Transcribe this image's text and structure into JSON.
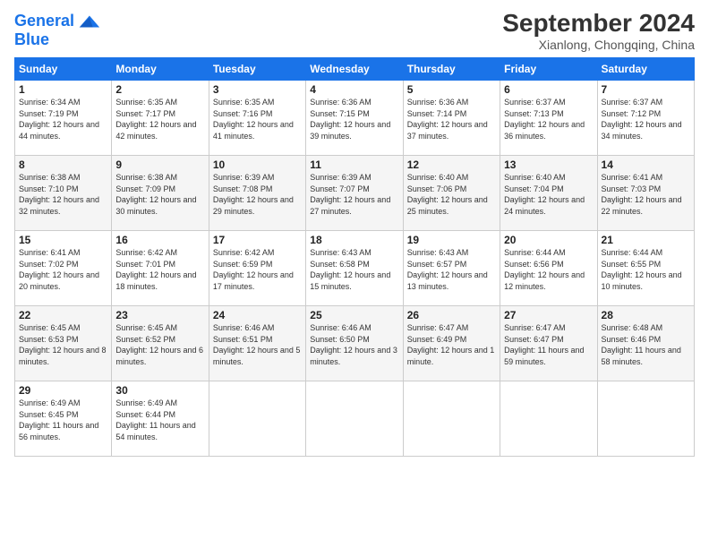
{
  "logo": {
    "line1": "General",
    "line2": "Blue"
  },
  "title": "September 2024",
  "location": "Xianlong, Chongqing, China",
  "weekdays": [
    "Sunday",
    "Monday",
    "Tuesday",
    "Wednesday",
    "Thursday",
    "Friday",
    "Saturday"
  ],
  "weeks": [
    [
      {
        "day": "1",
        "sunrise": "6:34 AM",
        "sunset": "7:19 PM",
        "daylight": "12 hours and 44 minutes."
      },
      {
        "day": "2",
        "sunrise": "6:35 AM",
        "sunset": "7:17 PM",
        "daylight": "12 hours and 42 minutes."
      },
      {
        "day": "3",
        "sunrise": "6:35 AM",
        "sunset": "7:16 PM",
        "daylight": "12 hours and 41 minutes."
      },
      {
        "day": "4",
        "sunrise": "6:36 AM",
        "sunset": "7:15 PM",
        "daylight": "12 hours and 39 minutes."
      },
      {
        "day": "5",
        "sunrise": "6:36 AM",
        "sunset": "7:14 PM",
        "daylight": "12 hours and 37 minutes."
      },
      {
        "day": "6",
        "sunrise": "6:37 AM",
        "sunset": "7:13 PM",
        "daylight": "12 hours and 36 minutes."
      },
      {
        "day": "7",
        "sunrise": "6:37 AM",
        "sunset": "7:12 PM",
        "daylight": "12 hours and 34 minutes."
      }
    ],
    [
      {
        "day": "8",
        "sunrise": "6:38 AM",
        "sunset": "7:10 PM",
        "daylight": "12 hours and 32 minutes."
      },
      {
        "day": "9",
        "sunrise": "6:38 AM",
        "sunset": "7:09 PM",
        "daylight": "12 hours and 30 minutes."
      },
      {
        "day": "10",
        "sunrise": "6:39 AM",
        "sunset": "7:08 PM",
        "daylight": "12 hours and 29 minutes."
      },
      {
        "day": "11",
        "sunrise": "6:39 AM",
        "sunset": "7:07 PM",
        "daylight": "12 hours and 27 minutes."
      },
      {
        "day": "12",
        "sunrise": "6:40 AM",
        "sunset": "7:06 PM",
        "daylight": "12 hours and 25 minutes."
      },
      {
        "day": "13",
        "sunrise": "6:40 AM",
        "sunset": "7:04 PM",
        "daylight": "12 hours and 24 minutes."
      },
      {
        "day": "14",
        "sunrise": "6:41 AM",
        "sunset": "7:03 PM",
        "daylight": "12 hours and 22 minutes."
      }
    ],
    [
      {
        "day": "15",
        "sunrise": "6:41 AM",
        "sunset": "7:02 PM",
        "daylight": "12 hours and 20 minutes."
      },
      {
        "day": "16",
        "sunrise": "6:42 AM",
        "sunset": "7:01 PM",
        "daylight": "12 hours and 18 minutes."
      },
      {
        "day": "17",
        "sunrise": "6:42 AM",
        "sunset": "6:59 PM",
        "daylight": "12 hours and 17 minutes."
      },
      {
        "day": "18",
        "sunrise": "6:43 AM",
        "sunset": "6:58 PM",
        "daylight": "12 hours and 15 minutes."
      },
      {
        "day": "19",
        "sunrise": "6:43 AM",
        "sunset": "6:57 PM",
        "daylight": "12 hours and 13 minutes."
      },
      {
        "day": "20",
        "sunrise": "6:44 AM",
        "sunset": "6:56 PM",
        "daylight": "12 hours and 12 minutes."
      },
      {
        "day": "21",
        "sunrise": "6:44 AM",
        "sunset": "6:55 PM",
        "daylight": "12 hours and 10 minutes."
      }
    ],
    [
      {
        "day": "22",
        "sunrise": "6:45 AM",
        "sunset": "6:53 PM",
        "daylight": "12 hours and 8 minutes."
      },
      {
        "day": "23",
        "sunrise": "6:45 AM",
        "sunset": "6:52 PM",
        "daylight": "12 hours and 6 minutes."
      },
      {
        "day": "24",
        "sunrise": "6:46 AM",
        "sunset": "6:51 PM",
        "daylight": "12 hours and 5 minutes."
      },
      {
        "day": "25",
        "sunrise": "6:46 AM",
        "sunset": "6:50 PM",
        "daylight": "12 hours and 3 minutes."
      },
      {
        "day": "26",
        "sunrise": "6:47 AM",
        "sunset": "6:49 PM",
        "daylight": "12 hours and 1 minute."
      },
      {
        "day": "27",
        "sunrise": "6:47 AM",
        "sunset": "6:47 PM",
        "daylight": "11 hours and 59 minutes."
      },
      {
        "day": "28",
        "sunrise": "6:48 AM",
        "sunset": "6:46 PM",
        "daylight": "11 hours and 58 minutes."
      }
    ],
    [
      {
        "day": "29",
        "sunrise": "6:49 AM",
        "sunset": "6:45 PM",
        "daylight": "11 hours and 56 minutes."
      },
      {
        "day": "30",
        "sunrise": "6:49 AM",
        "sunset": "6:44 PM",
        "daylight": "11 hours and 54 minutes."
      },
      null,
      null,
      null,
      null,
      null
    ]
  ]
}
